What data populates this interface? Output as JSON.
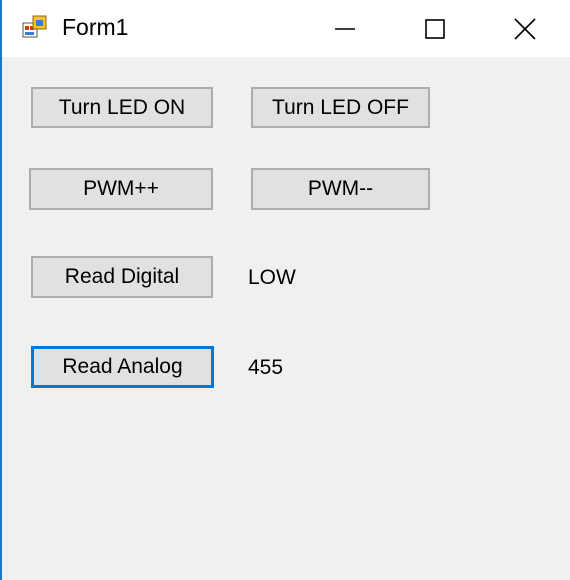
{
  "window": {
    "title": "Form1",
    "app_icon": "winforms-app-icon",
    "controls": {
      "minimize_icon": "minimize-icon",
      "maximize_icon": "maximize-icon",
      "close_icon": "close-icon"
    }
  },
  "buttons": {
    "turn_led_on": "Turn LED ON",
    "turn_led_off": "Turn LED OFF",
    "pwm_up": "PWM++",
    "pwm_down": "PWM--",
    "read_digital": "Read Digital",
    "read_analog": "Read Analog"
  },
  "labels": {
    "digital_value": "LOW",
    "analog_value": "455"
  },
  "colors": {
    "focus_border": "#0078d7",
    "window_accent": "#1979ca",
    "button_face": "#e1e1e1",
    "form_background": "#f0f0f0"
  }
}
